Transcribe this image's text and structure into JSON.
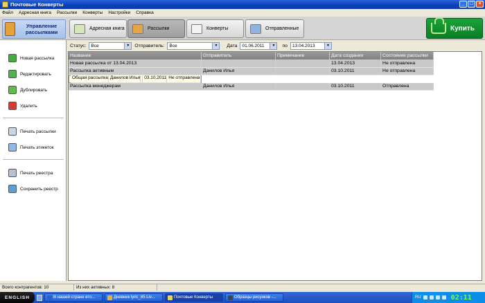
{
  "window": {
    "title": "Почтовые Конверты"
  },
  "menu": [
    "Файл",
    "Адресная книга",
    "Рассылки",
    "Конверты",
    "Настройки",
    "Справка"
  ],
  "management": {
    "label": "Управление рассылками"
  },
  "tabs": [
    {
      "label": "Адресная книга",
      "icon": "address-book-icon"
    },
    {
      "label": "Рассылки",
      "icon": "mailings-icon"
    },
    {
      "label": "Конверты",
      "icon": "envelope-icon"
    },
    {
      "label": "Отправленные",
      "icon": "sent-icon"
    }
  ],
  "buy": {
    "label": "Купить"
  },
  "sidebar": {
    "actions": [
      "Новая рассылка",
      "Редактировать",
      "Дублировать",
      "Удалить"
    ],
    "print": [
      "Печать рассылки",
      "Печать этикеток"
    ],
    "registry": [
      "Печать реестра",
      "Сохранить реестр"
    ]
  },
  "filters": {
    "status_label": "Статус:",
    "status_value": "Все",
    "sender_label": "Отправитель:",
    "sender_value": "Все",
    "date_label": "Дата",
    "date_from": "01.06.2011",
    "to_label": "по",
    "date_to": "13.04.2013"
  },
  "grid": {
    "columns": [
      "Название",
      "Отправитель",
      "Примечание",
      "Дата создания",
      "Состояние рассылки"
    ],
    "rows": [
      [
        "Новая рассылка от 13.04.2013",
        "",
        "",
        "13.04.2013",
        "Не отправлена"
      ],
      [
        "Рассылка активным",
        "Данилов Илья",
        "",
        "03.10.2011",
        "Не отправлена"
      ],
      [
        "Общая рассылка",
        "Данилов Илья",
        "",
        "03.10.2011",
        "Не отправлена"
      ],
      [
        "Рассылка менеджерам",
        "Данилов Илья",
        "",
        "03.10.2011",
        "Отправлена"
      ]
    ]
  },
  "status": {
    "total": "Всего контрагентов: 10",
    "active": "Из них активных: 8"
  },
  "taskbar": {
    "start": "ENGLISH",
    "tasks": [
      "В нашей стране вто...",
      "Дневник lyric_85 Liv...",
      "Почтовые Конверты",
      "Образцы рисунков -..."
    ],
    "lang": "RU",
    "clock": "02:11"
  }
}
